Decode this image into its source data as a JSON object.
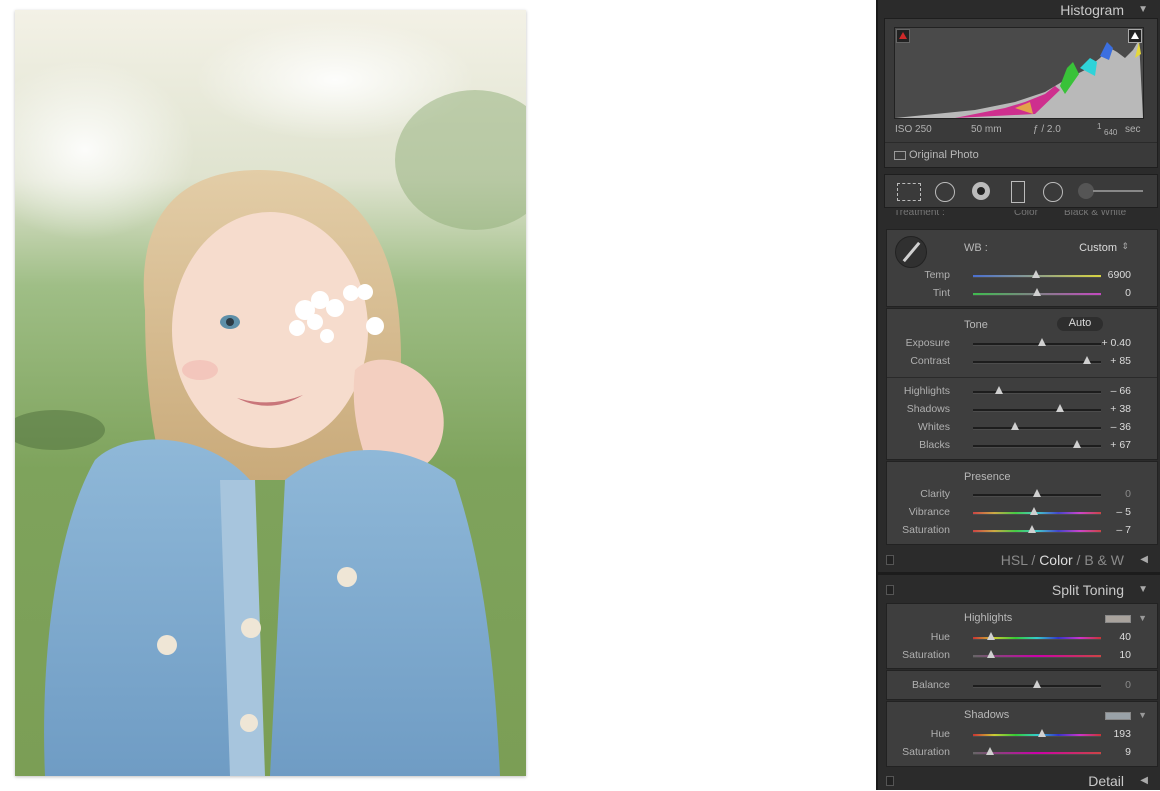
{
  "histogram": {
    "title": "Histogram",
    "iso": "ISO 250",
    "focal": "50 mm",
    "aperture": "ƒ / 2.0",
    "shutter_num": "1",
    "shutter_den": "640",
    "shutter_unit": "sec",
    "original_photo_label": "Original Photo"
  },
  "tools": [
    "crop-overlay-icon",
    "spot-removal-icon",
    "red-eye-icon",
    "graduated-filter-icon",
    "radial-filter-icon",
    "adjustment-brush-icon"
  ],
  "basic": {
    "partial_top_left": "Treatment :",
    "partial_top_mid": "Color",
    "partial_top_right": "Black & White",
    "wb_label": "WB :",
    "wb_value": "Custom",
    "temp": {
      "label": "Temp",
      "value": "6900",
      "position": 0.49
    },
    "tint": {
      "label": "Tint",
      "value": "0",
      "position": 0.5
    },
    "tone_label": "Tone",
    "auto_label": "Auto",
    "exposure": {
      "label": "Exposure",
      "value": "+ 0.40",
      "position": 0.54
    },
    "contrast": {
      "label": "Contrast",
      "value": "+ 85",
      "position": 0.89
    },
    "highlights": {
      "label": "Highlights",
      "value": "– 66",
      "position": 0.2
    },
    "shadows": {
      "label": "Shadows",
      "value": "+ 38",
      "position": 0.68
    },
    "whites": {
      "label": "Whites",
      "value": "– 36",
      "position": 0.33
    },
    "blacks": {
      "label": "Blacks",
      "value": "+ 67",
      "position": 0.81
    },
    "presence_label": "Presence",
    "clarity": {
      "label": "Clarity",
      "value": "0",
      "position": 0.5
    },
    "vibrance": {
      "label": "Vibrance",
      "value": "– 5",
      "position": 0.48
    },
    "saturation": {
      "label": "Saturation",
      "value": "– 7",
      "position": 0.46
    }
  },
  "hsl": {
    "hsl_label": "HSL",
    "slash1": "/",
    "color_label": "Color",
    "slash2": "/",
    "bw_label": "B & W"
  },
  "split_toning": {
    "title": "Split Toning",
    "highlights_label": "Highlights",
    "highlights_color": "#a9a39d",
    "hl_hue": {
      "label": "Hue",
      "value": "40",
      "position": 0.14
    },
    "hl_sat": {
      "label": "Saturation",
      "value": "10",
      "position": 0.14
    },
    "balance": {
      "label": "Balance",
      "value": "0",
      "position": 0.5
    },
    "shadows_label": "Shadows",
    "shadows_color": "#9aa2a8",
    "sh_hue": {
      "label": "Hue",
      "value": "193",
      "position": 0.54
    },
    "sh_sat": {
      "label": "Saturation",
      "value": "9",
      "position": 0.13
    }
  },
  "detail": {
    "title": "Detail"
  }
}
